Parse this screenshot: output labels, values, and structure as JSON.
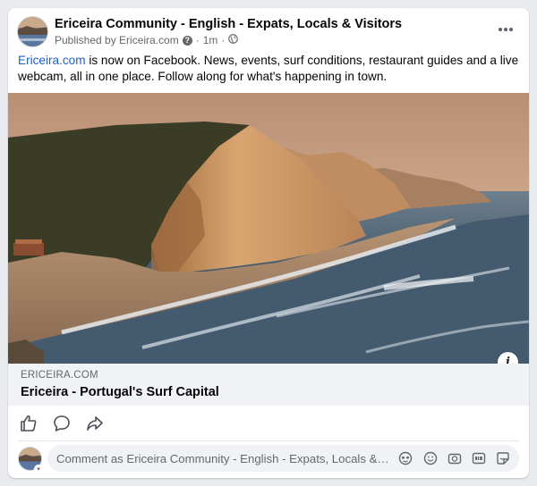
{
  "post": {
    "page_name": "Ericeira Community - English - Expats, Locals & Visitors",
    "published_by": "Published by Ericeira.com",
    "time": "1m",
    "audience_icon": "globe-icon",
    "text_link": "Ericeira.com",
    "text_body": " is now on Facebook. News, events, surf conditions, restaurant guides and a live webcam, all in one place. Follow along for what's happening in town."
  },
  "link_preview": {
    "domain": "ERICEIRA.COM",
    "title": "Ericeira - Portugal's Surf Capital"
  },
  "actions": {
    "like_icon": "thumbs-up-icon",
    "comment_icon": "comment-bubble-icon",
    "share_icon": "share-arrow-icon"
  },
  "comment": {
    "placeholder": "Comment as Ericeira Community - English - Expats, Locals & Visitors",
    "icons": [
      "avatar-sticker-icon",
      "emoji-icon",
      "camera-icon",
      "gif-icon",
      "sticker-icon"
    ]
  },
  "colors": {
    "link": "#1d5fc9",
    "card": "#ffffff",
    "preview_bg": "#f0f2f5",
    "secondary_text": "#65676b"
  }
}
